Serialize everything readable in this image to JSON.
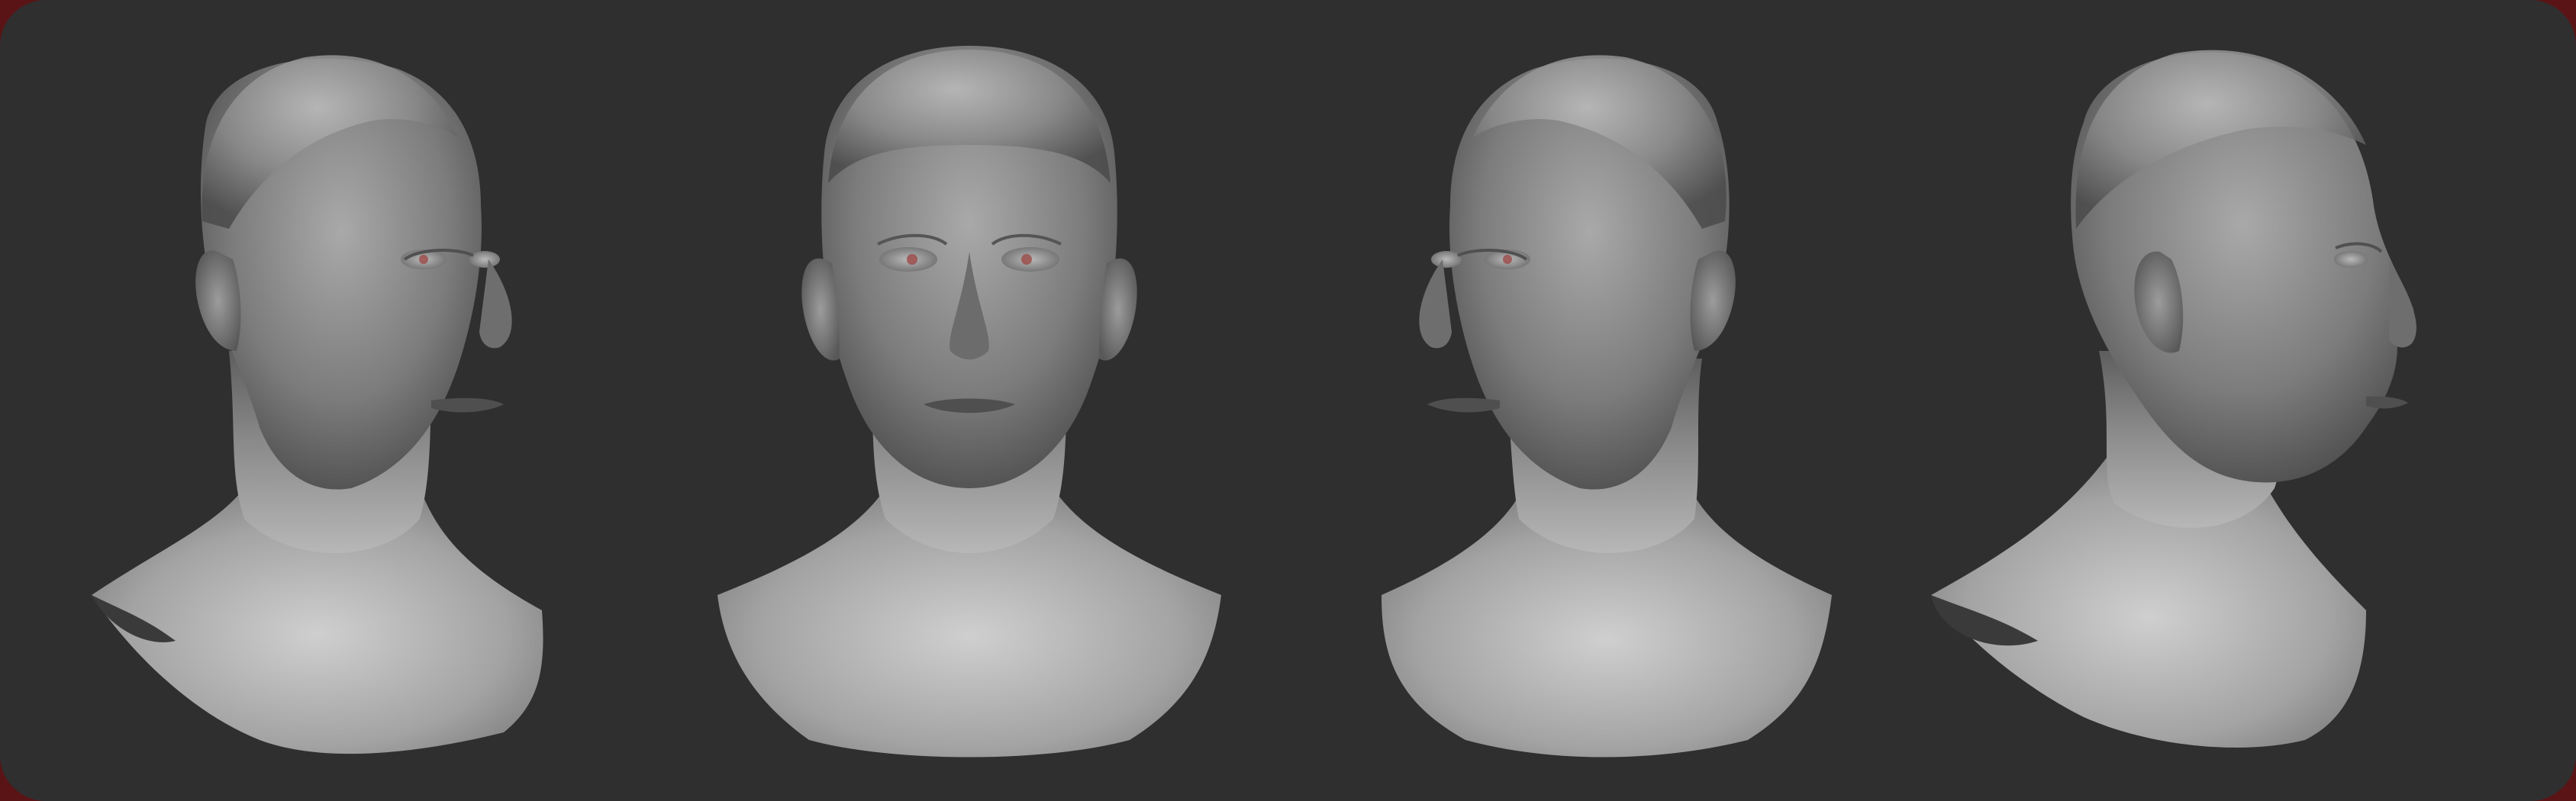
{
  "scene": {
    "description_colors": {
      "background": "#2f2f30",
      "border_accent": "#5a1416",
      "clay": "#8e8e8e",
      "clay_shadow": "#3e3e3f",
      "clay_highlight": "#c9c9c9",
      "iris_tint": "#b3403c"
    },
    "views": [
      {
        "id": "three-quarter-right"
      },
      {
        "id": "front"
      },
      {
        "id": "three-quarter-left"
      },
      {
        "id": "profile-right"
      }
    ]
  }
}
